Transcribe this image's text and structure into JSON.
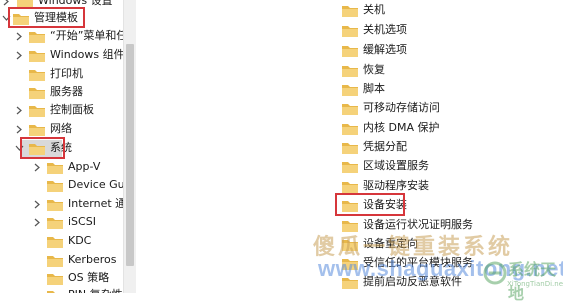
{
  "left_tree": {
    "items": [
      {
        "label": "Windows 设置"
      },
      {
        "label": "管理模板"
      },
      {
        "label": "“开始”菜单和任"
      },
      {
        "label": "Windows 组件"
      },
      {
        "label": "打印机"
      },
      {
        "label": "服务器"
      },
      {
        "label": "控制面板"
      },
      {
        "label": "网络"
      },
      {
        "label": "系统"
      },
      {
        "label": "App-V"
      },
      {
        "label": "Device Gu"
      },
      {
        "label": "Internet 通"
      },
      {
        "label": "iSCSI"
      },
      {
        "label": "KDC"
      },
      {
        "label": "Kerberos"
      },
      {
        "label": "OS 策略"
      },
      {
        "label": "PIN 复杂性"
      }
    ]
  },
  "right_list": {
    "items": [
      {
        "label": "关机"
      },
      {
        "label": "关机选项"
      },
      {
        "label": "缓解选项"
      },
      {
        "label": "恢复"
      },
      {
        "label": "脚本"
      },
      {
        "label": "可移动存储访问"
      },
      {
        "label": "内核 DMA 保护"
      },
      {
        "label": "凭据分配"
      },
      {
        "label": "区域设置服务"
      },
      {
        "label": "驱动程序安装"
      },
      {
        "label": "设备安装"
      },
      {
        "label": "设备运行状况证明服务"
      },
      {
        "label": "设备重定向"
      },
      {
        "label": "受信任的平台模块服务"
      },
      {
        "label": "提前启动反恶意软件"
      }
    ]
  },
  "highlight_color": "#d6363b",
  "folder_color": "#e8b84a",
  "watermark": {
    "cn_text": "傻瓜一键重装系统",
    "url_text": "www.shaguaxitong.net",
    "logo_text": "系统天地",
    "logo_sub": "XiTongTianDi.net"
  }
}
